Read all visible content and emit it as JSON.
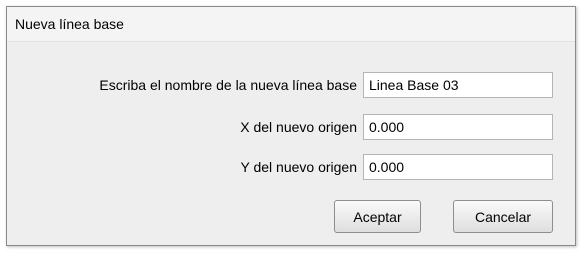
{
  "window": {
    "title": "Nueva línea base"
  },
  "form": {
    "name_label": "Escriba el nombre de la nueva línea base",
    "name_value": "Linea Base 03",
    "x_label": "X del nuevo origen",
    "x_value": "0.000",
    "y_label": "Y del nuevo origen",
    "y_value": "0.000"
  },
  "buttons": {
    "accept": "Aceptar",
    "cancel": "Cancelar"
  }
}
